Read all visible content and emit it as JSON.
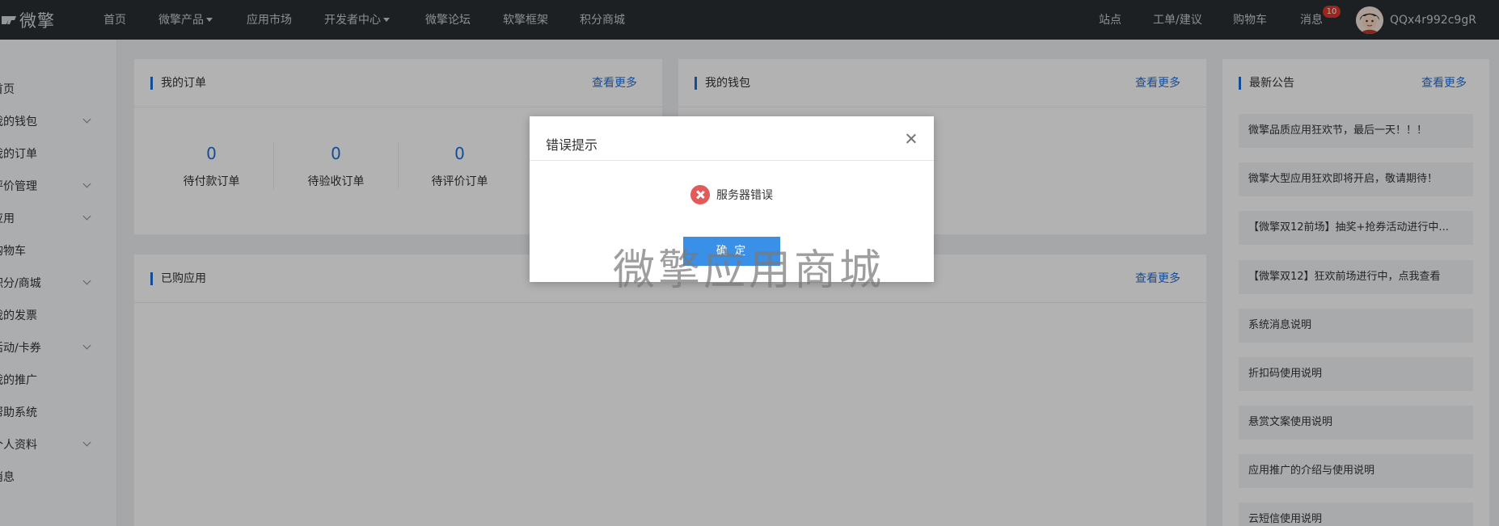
{
  "brand": {
    "name": "微擎"
  },
  "nav": [
    {
      "label": "首页",
      "dropdown": false
    },
    {
      "label": "微擎产品",
      "dropdown": true
    },
    {
      "label": "应用市场",
      "dropdown": false
    },
    {
      "label": "开发者中心",
      "dropdown": true
    },
    {
      "label": "微擎论坛",
      "dropdown": false
    },
    {
      "label": "软擎框架",
      "dropdown": false
    },
    {
      "label": "积分商城",
      "dropdown": false
    }
  ],
  "nav_right": {
    "site": "站点",
    "ticket": "工单/建议",
    "cart": "购物车",
    "messages": "消息",
    "messages_badge": "10",
    "username": "QQx4r992c9gR"
  },
  "sidebar": [
    {
      "label": "首页",
      "expandable": false
    },
    {
      "label": "我的钱包",
      "expandable": true
    },
    {
      "label": "我的订单",
      "expandable": false
    },
    {
      "label": "评价管理",
      "expandable": true
    },
    {
      "label": "应用",
      "expandable": true
    },
    {
      "label": "购物车",
      "expandable": false
    },
    {
      "label": "积分/商城",
      "expandable": true
    },
    {
      "label": "我的发票",
      "expandable": false
    },
    {
      "label": "活动/卡券",
      "expandable": true
    },
    {
      "label": "我的推广",
      "expandable": false
    },
    {
      "label": "帮助系统",
      "expandable": false
    },
    {
      "label": "个人资料",
      "expandable": true
    },
    {
      "label": "消息",
      "expandable": false
    }
  ],
  "orders": {
    "title": "我的订单",
    "more": "查看更多",
    "stats": [
      {
        "value": "0",
        "label": "待付款订单"
      },
      {
        "value": "0",
        "label": "待验收订单"
      },
      {
        "value": "0",
        "label": "待评价订单"
      }
    ]
  },
  "wallet": {
    "title": "我的钱包",
    "more": "查看更多"
  },
  "purchased": {
    "title": "已购应用",
    "more": "查看更多"
  },
  "announcements": {
    "title": "最新公告",
    "more": "查看更多",
    "items": [
      "微擎品质应用狂欢节，最后一天！！！",
      "微擎大型应用狂欢即将开启，敬请期待！",
      "【微擎双12前场】抽奖+抢券活动进行中...",
      "【微擎双12】狂欢前场进行中，点我查看",
      "系统消息说明",
      "折扣码使用说明",
      "悬赏文案使用说明",
      "应用推广的介绍与使用说明",
      "云短信使用说明"
    ]
  },
  "modal": {
    "title": "错误提示",
    "message": "服务器错误",
    "confirm": "确 定"
  },
  "watermark": "微擎应用商城",
  "colors": {
    "topbar": "#2a2e33",
    "accent": "#1e6fd9",
    "button": "#3990e6",
    "error": "#e25a5a",
    "badge": "#e0352b"
  }
}
